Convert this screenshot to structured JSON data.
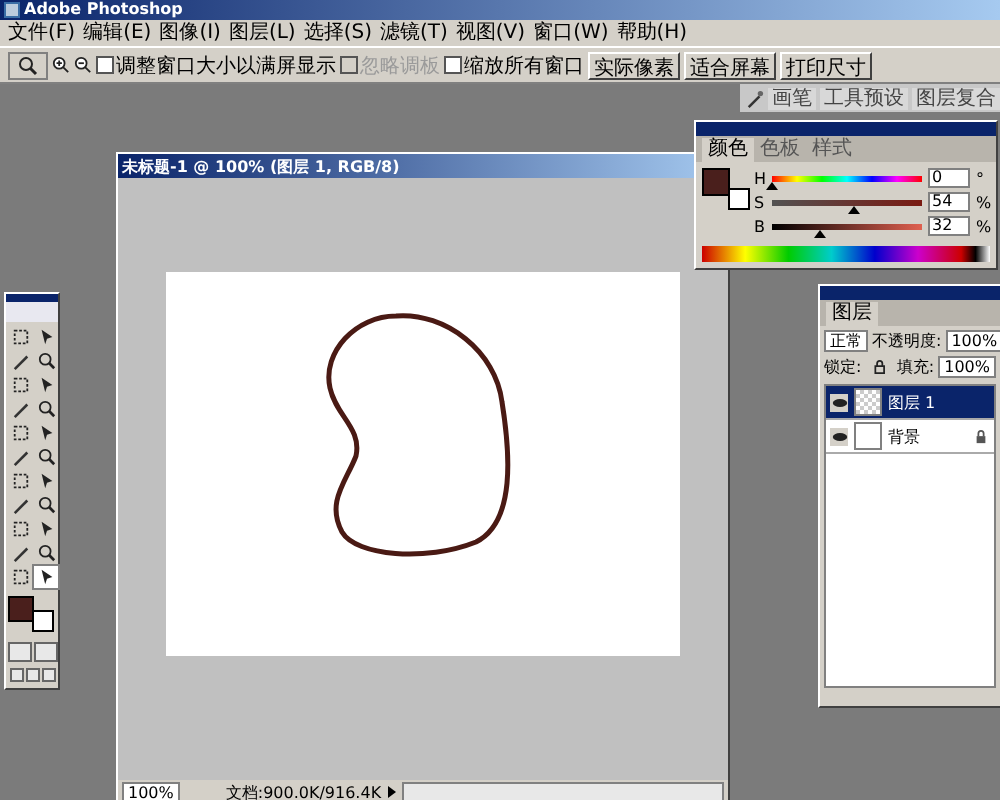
{
  "app_title": "Adobe Photoshop",
  "menu": [
    "文件(F)",
    "编辑(E)",
    "图像(I)",
    "图层(L)",
    "选择(S)",
    "滤镜(T)",
    "视图(V)",
    "窗口(W)",
    "帮助(H)"
  ],
  "options_bar": {
    "checkboxes": [
      {
        "label": "调整窗口大小以满屏显示",
        "checked": false,
        "disabled": false
      },
      {
        "label": "忽略调板",
        "checked": false,
        "disabled": true
      },
      {
        "label": "缩放所有窗口",
        "checked": false,
        "disabled": false
      }
    ],
    "buttons": [
      "实际像素",
      "适合屏幕",
      "打印尺寸"
    ]
  },
  "palette_well": {
    "tabs": [
      "画笔",
      "工具预设",
      "图层复合"
    ]
  },
  "document": {
    "title": "未标题-1 @ 100% (图层 1, RGB/8)",
    "zoom": "100%",
    "status": "文档:900.0K/916.4K"
  },
  "color_palette": {
    "tabs": [
      {
        "label": "颜色",
        "selected": true
      },
      {
        "label": "色板",
        "selected": false
      },
      {
        "label": "样式",
        "selected": false
      }
    ],
    "swatches": [
      {
        "kind": "foreground",
        "color": "#4a1f1c"
      },
      {
        "kind": "background",
        "color": "#ffffff"
      }
    ],
    "sliders": [
      {
        "label": "H",
        "value": "0",
        "unit": "°",
        "level": 0.0
      },
      {
        "label": "S",
        "value": "54",
        "unit": "%",
        "level": 0.54
      },
      {
        "label": "B",
        "value": "32",
        "unit": "%",
        "level": 0.32
      }
    ]
  },
  "layers_palette": {
    "tab": "图层",
    "blend_mode": "正常",
    "opacity_label": "不透明度:",
    "opacity": "100%",
    "lock_label": "锁定:",
    "fill_label": "填充:",
    "fill": "100%",
    "layers": [
      {
        "name": "图层 1",
        "selected": true,
        "visible": true,
        "locked": false,
        "kind": "transparent"
      },
      {
        "name": "背景",
        "selected": false,
        "visible": true,
        "locked": true,
        "kind": "white"
      }
    ]
  }
}
